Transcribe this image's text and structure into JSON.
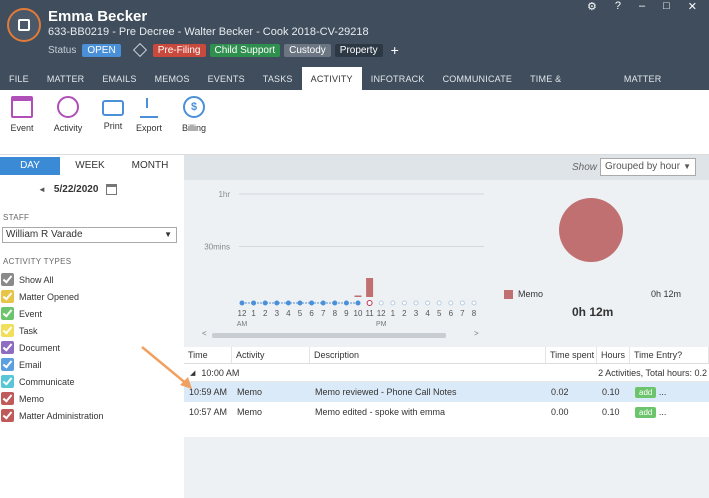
{
  "header": {
    "client_name": "Emma Becker",
    "matter_line": "633-BB0219 - Pre Decree - Walter Becker - Cook 2018-CV-29218",
    "status_label": "Status",
    "status_value": "OPEN",
    "tags": [
      {
        "label": "Pre-Filing",
        "color": "#c94a3c"
      },
      {
        "label": "Child Support",
        "color": "#2f8f4e"
      },
      {
        "label": "Custody",
        "color": "#6b7682"
      },
      {
        "label": "Property",
        "color": "#2d3845"
      }
    ],
    "add_tag": "+",
    "window_buttons": {
      "settings": "⚙",
      "help": "?",
      "minimize": "–",
      "maximize": "□",
      "close": "✕"
    }
  },
  "tabs": [
    {
      "label": "FILE"
    },
    {
      "label": "MATTER"
    },
    {
      "label": "EMAILS"
    },
    {
      "label": "MEMOS"
    },
    {
      "label": "EVENTS"
    },
    {
      "label": "TASKS"
    },
    {
      "label": "ACTIVITY",
      "active": true
    },
    {
      "label": "INFOTRACK"
    },
    {
      "label": "COMMUNICATE"
    },
    {
      "label": "TIME & EXPENSES"
    },
    {
      "label": "MATTER INSIGHTS"
    }
  ],
  "ribbon": {
    "event": "Event",
    "activity": "Activity",
    "print": "Print",
    "export": "Export",
    "billing": "Billing",
    "billing_symbol": "$"
  },
  "sidebar": {
    "periods": [
      "DAY",
      "WEEK",
      "MONTH"
    ],
    "date": "5/22/2020",
    "prev_arrow": "◄",
    "staff_heading": "STAFF",
    "staff_value": "William R Varade",
    "types_heading": "ACTIVITY TYPES",
    "types": [
      {
        "label": "Show All",
        "color": "#8a8a8a"
      },
      {
        "label": "Matter Opened",
        "color": "#e8c447"
      },
      {
        "label": "Event",
        "color": "#6cc56c"
      },
      {
        "label": "Task",
        "color": "#f1df5a"
      },
      {
        "label": "Document",
        "color": "#8e6cc0"
      },
      {
        "label": "Email",
        "color": "#5aa0e0"
      },
      {
        "label": "Communicate",
        "color": "#58c6d6"
      },
      {
        "label": "Memo",
        "color": "#c05a5a"
      },
      {
        "label": "Matter Administration",
        "color": "#c05a5a"
      }
    ]
  },
  "view": {
    "show_label": "Show",
    "show_value": "Grouped by hour"
  },
  "chart_data": {
    "type": "bar",
    "title": "",
    "ylabel": "",
    "y_tick_labels": [
      "1hr",
      "30mins"
    ],
    "ylim": [
      0,
      60
    ],
    "categories": [
      "12",
      "1",
      "2",
      "3",
      "4",
      "5",
      "6",
      "7",
      "8",
      "9",
      "10",
      "11",
      "12",
      "1",
      "2",
      "3",
      "4",
      "5",
      "6",
      "7",
      "8"
    ],
    "x_sublabels": {
      "0": "AM",
      "12": "PM"
    },
    "series": [
      {
        "name": "Memo",
        "values": [
          0,
          0,
          0,
          0,
          0,
          0,
          0,
          0,
          0,
          0,
          2,
          12,
          0,
          0,
          0,
          0,
          0,
          0,
          0,
          0,
          0
        ]
      }
    ],
    "pie": {
      "type": "pie",
      "slices": [
        {
          "label": "Memo",
          "value": 12
        }
      ]
    },
    "legend": [
      {
        "label": "Memo",
        "value": "0h 12m"
      }
    ],
    "total": "0h 12m"
  },
  "grid": {
    "columns": [
      "Time",
      "Activity",
      "Description",
      "Time spent",
      "Hours",
      "Time Entry?"
    ],
    "group_label": "10:00 AM",
    "group_summary": "2 Activities, Total hours: 0.2",
    "rows": [
      {
        "time": "10:59 AM",
        "activity": "Memo",
        "description": "Memo reviewed - Phone Call Notes",
        "time_spent": "0.02",
        "hours": "0.10",
        "entry": "add",
        "more": "..."
      },
      {
        "time": "10:57 AM",
        "activity": "Memo",
        "description": "Memo edited - spoke with emma",
        "time_spent": "0.00",
        "hours": "0.10",
        "entry": "add",
        "more": "..."
      }
    ]
  }
}
